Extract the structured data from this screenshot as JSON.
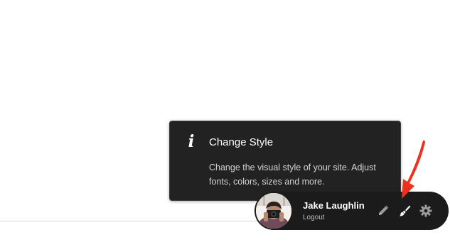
{
  "tooltip": {
    "icon": "info-icon",
    "title": "Change Style",
    "body": "Change the visual style of your site. Adjust fonts, colors, sizes and more."
  },
  "user_bar": {
    "avatar": "avatar",
    "name": "Jake Laughlin",
    "logout_label": "Logout",
    "icons": [
      "pencil-icon",
      "paintbrush-icon",
      "gear-icon"
    ]
  },
  "annotation": {
    "arrow_color": "#f0301e"
  }
}
